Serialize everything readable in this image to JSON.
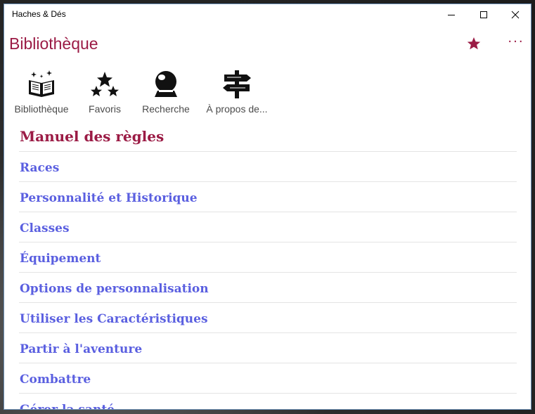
{
  "window": {
    "title": "Haches & Dés"
  },
  "header": {
    "title": "Bibliothèque",
    "more_label": "···"
  },
  "nav": {
    "items": [
      {
        "label": "Bibliothèque",
        "icon": "open-book-icon"
      },
      {
        "label": "Favoris",
        "icon": "stars-icon"
      },
      {
        "label": "Recherche",
        "icon": "crystal-ball-icon"
      },
      {
        "label": "À propos de...",
        "icon": "signpost-icon"
      }
    ]
  },
  "section": {
    "heading": "Manuel des règles",
    "items": [
      "Races",
      "Personnalité et Historique",
      "Classes",
      "Équipement",
      "Options de personnalisation",
      "Utiliser les Caractéristiques",
      "Partir à l'aventure",
      "Combattre",
      "Gérer la santé"
    ]
  },
  "colors": {
    "accent": "#9b1b45",
    "link": "#5a5fe0"
  }
}
